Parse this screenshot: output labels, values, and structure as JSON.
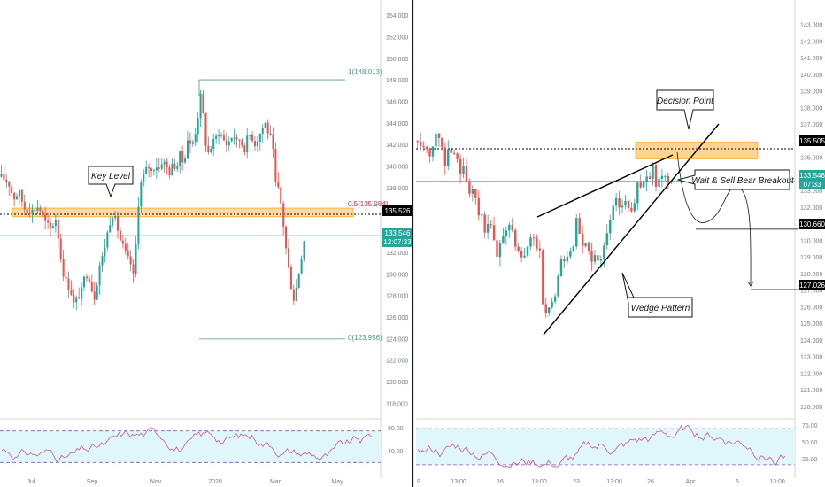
{
  "chart_data": [
    {
      "type": "candlestick",
      "title": "",
      "panel": "left",
      "y_axis_ticks": [
        "154.000",
        "152.000",
        "150.000",
        "148.000",
        "146.000",
        "144.000",
        "142.000",
        "140.000",
        "138.000",
        "136.000",
        "134.000",
        "132.000",
        "130.000",
        "128.000",
        "126.000",
        "124.000",
        "122.000",
        "120.000",
        "118.000"
      ],
      "x_axis_ticks": [
        "Jul",
        "Sep",
        "Nov",
        "2020",
        "Mar",
        "May"
      ],
      "ylim": [
        116.8,
        155.0
      ],
      "price_path": [
        [
          0,
          139
        ],
        [
          8,
          138.5
        ],
        [
          14,
          137
        ],
        [
          20,
          137.6
        ],
        [
          26,
          136.1
        ],
        [
          34,
          135.8
        ],
        [
          42,
          136.3
        ],
        [
          50,
          134.7
        ],
        [
          56,
          134.2
        ],
        [
          62,
          135.2
        ],
        [
          66,
          132.2
        ],
        [
          70,
          130.1
        ],
        [
          74,
          129.1
        ],
        [
          78,
          128.6
        ],
        [
          82,
          127.2
        ],
        [
          86,
          127.8
        ],
        [
          90,
          128.2
        ],
        [
          94,
          129.7
        ],
        [
          98,
          130.1
        ],
        [
          102,
          128.6
        ],
        [
          106,
          127.7
        ],
        [
          110,
          130.6
        ],
        [
          114,
          131.5
        ],
        [
          118,
          133.0
        ],
        [
          122,
          134.7
        ],
        [
          126,
          135.6
        ],
        [
          130,
          134.7
        ],
        [
          134,
          133.2
        ],
        [
          138,
          132.4
        ],
        [
          142,
          131.5
        ],
        [
          146,
          131.0
        ],
        [
          150,
          129.4
        ],
        [
          154,
          136.0
        ],
        [
          158,
          138.5
        ],
        [
          162,
          139.4
        ],
        [
          166,
          140.0
        ],
        [
          170,
          139.4
        ],
        [
          174,
          140.2
        ],
        [
          178,
          139.7
        ],
        [
          182,
          140.6
        ],
        [
          186,
          140.0
        ],
        [
          190,
          139.4
        ],
        [
          194,
          140.2
        ],
        [
          198,
          139.8
        ],
        [
          202,
          141.2
        ],
        [
          206,
          140.0
        ],
        [
          210,
          142.6
        ],
        [
          214,
          141.8
        ],
        [
          218,
          142.6
        ],
        [
          222,
          144.6
        ],
        [
          226,
          147.0
        ],
        [
          230,
          142.4
        ],
        [
          234,
          141.2
        ],
        [
          238,
          142.0
        ],
        [
          242,
          142.6
        ],
        [
          246,
          143.2
        ],
        [
          250,
          142.6
        ],
        [
          254,
          142.0
        ],
        [
          258,
          142.4
        ],
        [
          262,
          143.0
        ],
        [
          266,
          142.2
        ],
        [
          270,
          142.6
        ],
        [
          274,
          141.4
        ],
        [
          278,
          142.6
        ],
        [
          282,
          143.0
        ],
        [
          286,
          142.0
        ],
        [
          290,
          142.6
        ],
        [
          294,
          143.4
        ],
        [
          298,
          144.0
        ],
        [
          302,
          143.0
        ],
        [
          306,
          142.2
        ],
        [
          310,
          138.2
        ],
        [
          314,
          137.6
        ],
        [
          318,
          135.0
        ],
        [
          322,
          132.0
        ],
        [
          326,
          129.6
        ],
        [
          330,
          127.6
        ],
        [
          334,
          129.0
        ],
        [
          338,
          131.2
        ],
        [
          342,
          133.2
        ]
      ],
      "fibonacci": {
        "level_1": "1(148.013)",
        "level_05": "0.5(135.984)",
        "level_0": "0(123.956)",
        "values": [
          148.013,
          135.984,
          123.956
        ]
      },
      "key_level_zone": [
        135.3,
        136.1
      ],
      "dashed_level": 135.526,
      "current_price_line": 133.546,
      "price_labels": {
        "level": "135.526",
        "current": "133.546",
        "countdown": "12:07:33"
      },
      "annotations": [
        {
          "text": "Key Level"
        }
      ],
      "rsi": {
        "ticks": [
          "80.00",
          "40.00"
        ],
        "upper": 80,
        "lower": 30,
        "band_color": "#e0f7fa"
      }
    },
    {
      "type": "candlestick",
      "title": "",
      "panel": "right",
      "y_axis_ticks": [
        "143.000",
        "142.000",
        "141.000",
        "140.000",
        "139.000",
        "138.000",
        "137.000",
        "136.000",
        "135.000",
        "134.000",
        "133.000",
        "132.000",
        "131.000",
        "130.000",
        "129.000",
        "128.000",
        "127.000",
        "126.000",
        "125.000",
        "124.000",
        "123.000",
        "122.000",
        "121.000",
        "120.000"
      ],
      "x_axis_ticks": [
        "9",
        "13:00",
        "16",
        "13:00",
        "23",
        "13:00",
        "26",
        "Apr",
        "6",
        "13:00"
      ],
      "ylim": [
        119.4,
        144.2
      ],
      "price_path": [
        [
          0,
          136.0
        ],
        [
          8,
          135.6
        ],
        [
          14,
          135.2
        ],
        [
          20,
          136.4
        ],
        [
          26,
          136.0
        ],
        [
          30,
          134.4
        ],
        [
          34,
          135.6
        ],
        [
          38,
          134.9
        ],
        [
          42,
          135.3
        ],
        [
          46,
          134.0
        ],
        [
          50,
          134.6
        ],
        [
          54,
          133.6
        ],
        [
          58,
          132.6
        ],
        [
          62,
          133.2
        ],
        [
          66,
          131.2
        ],
        [
          70,
          131.8
        ],
        [
          74,
          130.4
        ],
        [
          78,
          131.0
        ],
        [
          82,
          130.6
        ],
        [
          86,
          128.8
        ],
        [
          90,
          129.6
        ],
        [
          94,
          130.2
        ],
        [
          98,
          130.9
        ],
        [
          102,
          130.8
        ],
        [
          106,
          130.0
        ],
        [
          110,
          129.4
        ],
        [
          114,
          128.8
        ],
        [
          118,
          129.2
        ],
        [
          122,
          129.8
        ],
        [
          126,
          130.3
        ],
        [
          130,
          129.8
        ],
        [
          134,
          129.2
        ],
        [
          138,
          125.5
        ],
        [
          142,
          125.8
        ],
        [
          146,
          126.0
        ],
        [
          150,
          126.4
        ],
        [
          154,
          127.6
        ],
        [
          158,
          129.0
        ],
        [
          162,
          128.3
        ],
        [
          166,
          129.8
        ],
        [
          170,
          129.0
        ],
        [
          174,
          131.2
        ],
        [
          178,
          130.2
        ],
        [
          182,
          129.4
        ],
        [
          186,
          129.8
        ],
        [
          190,
          128.8
        ],
        [
          194,
          129.0
        ],
        [
          198,
          128.7
        ],
        [
          202,
          129.2
        ],
        [
          206,
          130.0
        ],
        [
          210,
          131.0
        ],
        [
          214,
          132.0
        ],
        [
          218,
          132.6
        ],
        [
          222,
          131.8
        ],
        [
          226,
          132.6
        ],
        [
          230,
          132.0
        ],
        [
          234,
          131.8
        ],
        [
          238,
          132.4
        ],
        [
          242,
          133.6
        ],
        [
          246,
          133.0
        ],
        [
          250,
          134.0
        ],
        [
          254,
          133.4
        ],
        [
          258,
          134.4
        ],
        [
          262,
          133.2
        ],
        [
          266,
          133.8
        ],
        [
          270,
          134.0
        ],
        [
          274,
          133.6
        ],
        [
          278,
          133.5
        ]
      ],
      "decision_zone": [
        134.9,
        135.9
      ],
      "dashed_level": 135.505,
      "current_price_line": 133.546,
      "projection_targets": [
        130.66,
        127.026
      ],
      "price_labels": {
        "level": "135.505",
        "current": "133.546",
        "countdown": "07:33",
        "target_1": "130.660",
        "target_2": "127.026"
      },
      "annotations": [
        {
          "text": "Decision Point"
        },
        {
          "text": "Wait & Sell Bear Breakout"
        },
        {
          "text": "Wedge Pattern"
        }
      ],
      "rsi": {
        "ticks": [
          "75.00",
          "50.00",
          "25.00"
        ],
        "upper": 75,
        "lower": 25,
        "band_color": "#e0f7fa"
      }
    }
  ],
  "colors": {
    "up": "#26a69a",
    "down": "#ef5350",
    "fib": "#4a9a8a",
    "fib_mid": "#e91e63",
    "zone_fill": "#ffcc80",
    "zone_stroke": "#f5a623",
    "rsi_line": "#d14fa0",
    "rsi_dash": "#7e57c2",
    "axis_text": "#787b86",
    "black": "#000000",
    "current_label": "#26a69a"
  }
}
